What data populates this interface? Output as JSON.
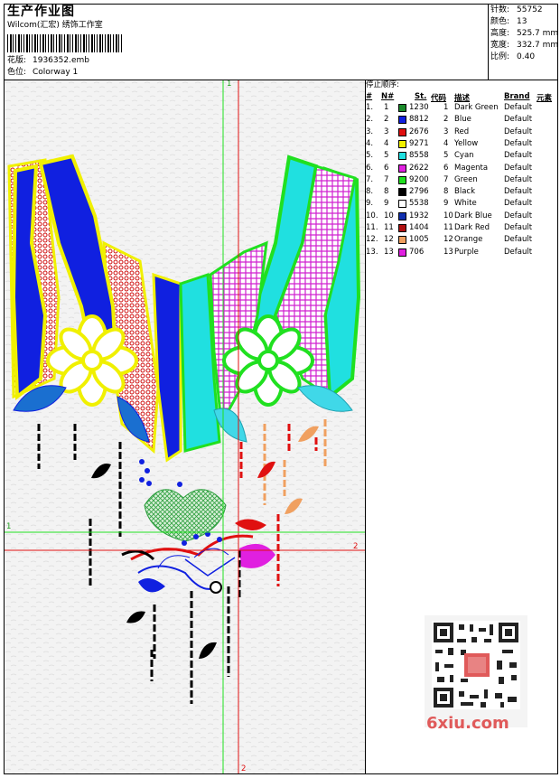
{
  "header": {
    "title": "生产作业图",
    "company": "Wilcom(汇宏) 绣饰工作室",
    "design_label": "花版:",
    "design_value": "1936352.emb",
    "colorway_label": "色位:",
    "colorway_value": "Colorway 1"
  },
  "stats": {
    "stitches_label": "针数:",
    "stitches_value": "55752",
    "colors_label": "颜色:",
    "colors_value": "13",
    "height_label": "高度:",
    "height_value": "525.7 mm",
    "width_label": "宽度:",
    "width_value": "332.7 mm",
    "scale_label": "比例:",
    "scale_value": "0.40"
  },
  "canvas": {
    "marker_v1_top": "1",
    "marker_h1_left": "1",
    "marker_h2_right": "2",
    "marker_v2_bottom": "2"
  },
  "legend": {
    "title": "停止顺序:",
    "headers": {
      "index": "#",
      "number": "N#",
      "stitches": "St.",
      "code": "代码",
      "description": "描述",
      "brand": "Brand",
      "element": "元素"
    },
    "rows": [
      {
        "index": "1.",
        "n": "1",
        "color": "#1a8a2a",
        "st": "1230",
        "code": "1",
        "desc": "Dark Green",
        "brand": "Default"
      },
      {
        "index": "2.",
        "n": "2",
        "color": "#1020e0",
        "st": "8812",
        "code": "2",
        "desc": "Blue",
        "brand": "Default"
      },
      {
        "index": "3.",
        "n": "3",
        "color": "#e01010",
        "st": "2676",
        "code": "3",
        "desc": "Red",
        "brand": "Default"
      },
      {
        "index": "4.",
        "n": "4",
        "color": "#f0f000",
        "st": "9271",
        "code": "4",
        "desc": "Yellow",
        "brand": "Default"
      },
      {
        "index": "5.",
        "n": "5",
        "color": "#20e0e0",
        "st": "8558",
        "code": "5",
        "desc": "Cyan",
        "brand": "Default"
      },
      {
        "index": "6.",
        "n": "6",
        "color": "#e020e0",
        "st": "2622",
        "code": "6",
        "desc": "Magenta",
        "brand": "Default"
      },
      {
        "index": "7.",
        "n": "7",
        "color": "#20e020",
        "st": "9200",
        "code": "7",
        "desc": "Green",
        "brand": "Default"
      },
      {
        "index": "8.",
        "n": "8",
        "color": "#000000",
        "st": "2796",
        "code": "8",
        "desc": "Black",
        "brand": "Default"
      },
      {
        "index": "9.",
        "n": "9",
        "color": "#ffffff",
        "st": "5538",
        "code": "9",
        "desc": "White",
        "brand": "Default"
      },
      {
        "index": "10.",
        "n": "10",
        "color": "#1030b0",
        "st": "1932",
        "code": "10",
        "desc": "Dark Blue",
        "brand": "Default"
      },
      {
        "index": "11.",
        "n": "11",
        "color": "#b01010",
        "st": "1404",
        "code": "11",
        "desc": "Dark Red",
        "brand": "Default"
      },
      {
        "index": "12.",
        "n": "12",
        "color": "#f0a060",
        "st": "1005",
        "code": "12",
        "desc": "Orange",
        "brand": "Default"
      },
      {
        "index": "13.",
        "n": "13",
        "color": "#e020e0",
        "st": "706",
        "code": "13",
        "desc": "Purple",
        "brand": "Default"
      }
    ]
  },
  "watermark": {
    "text": "6xiu.com",
    "qr_icon": "qr-code-icon"
  }
}
